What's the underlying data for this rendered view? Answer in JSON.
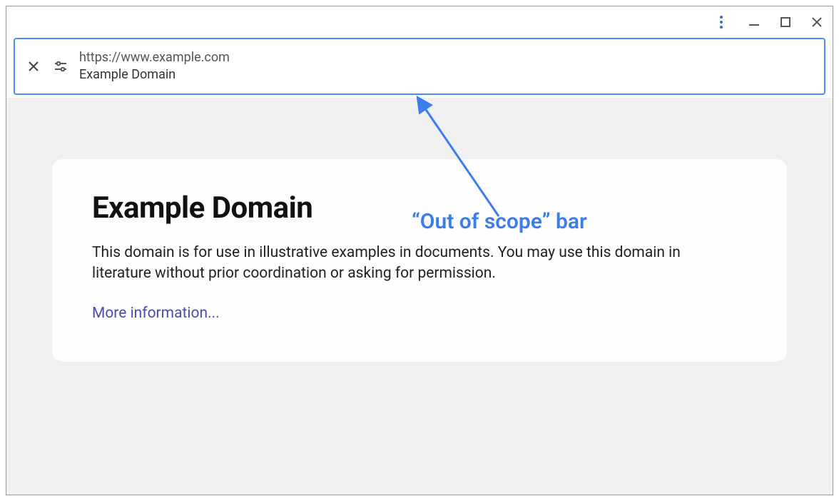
{
  "window_controls": {
    "more_menu": "more-vert",
    "minimize": "minimize",
    "maximize": "maximize",
    "close": "close"
  },
  "scope_bar": {
    "close_tab": "close",
    "tune": "tune",
    "url": "https://www.example.com",
    "page_title": "Example Domain"
  },
  "content": {
    "heading": "Example Domain",
    "paragraph": "This domain is for use in illustrative examples in documents. You may use this domain in literature without prior coordination or asking for permission.",
    "link_text": "More information..."
  },
  "annotation": {
    "label": "“Out of scope” bar"
  },
  "colors": {
    "accent": "#4b8bf4",
    "annotation": "#3c7ced",
    "link": "#4a4ea8",
    "content_bg": "#f0f0f0"
  }
}
